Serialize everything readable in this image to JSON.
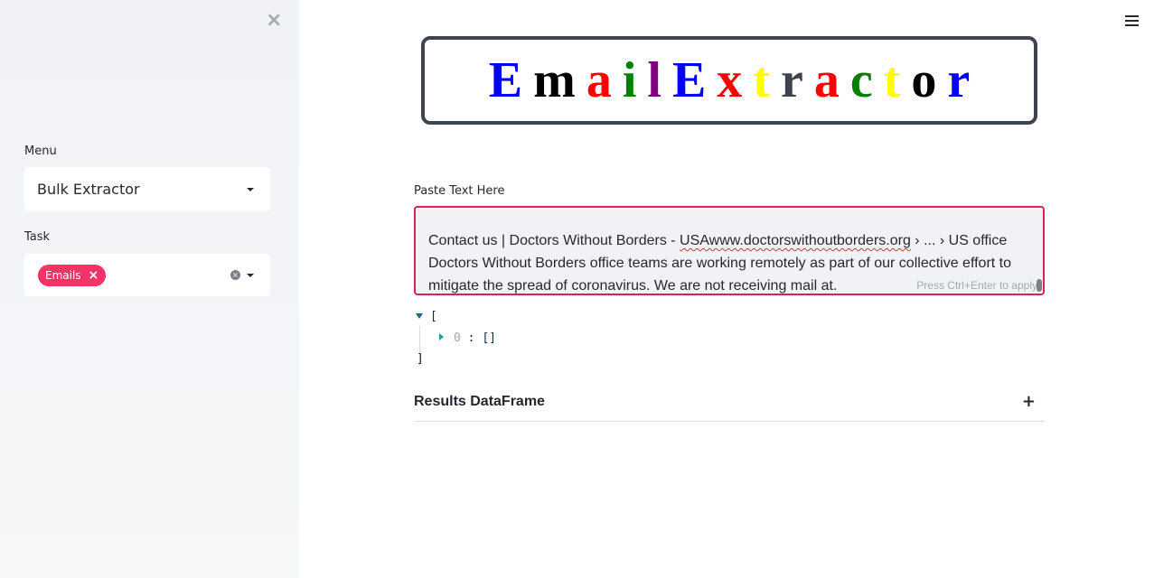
{
  "sidebar": {
    "close_glyph": "×",
    "menu": {
      "label": "Menu",
      "selected": "Bulk Extractor"
    },
    "task": {
      "label": "Task",
      "chips": [
        {
          "label": "Emails",
          "remove_glyph": "×"
        }
      ],
      "clear_glyph": "×"
    }
  },
  "header": {
    "menu_icon": "hamburger-icon"
  },
  "title": {
    "letters": [
      {
        "char": "E",
        "color": "#0000ff"
      },
      {
        "char": "m",
        "color": "#000000"
      },
      {
        "char": "a",
        "color": "#ff0000"
      },
      {
        "char": "i",
        "color": "#008000"
      },
      {
        "char": "l",
        "color": "#800080"
      },
      {
        "char": "E",
        "color": "#0000ff"
      },
      {
        "char": "x",
        "color": "#ff0000"
      },
      {
        "char": "t",
        "color": "#ffff00"
      },
      {
        "char": "r",
        "color": "#3d4450"
      },
      {
        "char": "a",
        "color": "#ff0000"
      },
      {
        "char": "c",
        "color": "#008000"
      },
      {
        "char": "t",
        "color": "#ffff00"
      },
      {
        "char": "o",
        "color": "#000000"
      },
      {
        "char": "r",
        "color": "#0000ff"
      }
    ]
  },
  "paste": {
    "label": "Paste Text Here",
    "text_segments": [
      {
        "text": "Contact us | Doctors Without Borders - ",
        "squiggle": false
      },
      {
        "text": "USAwww.doctorswithoutborders.org",
        "squiggle": true
      },
      {
        "text": " › ... › US office Doctors Without Borders office teams are working remotely as part of our collective effort to mitigate the spread of ",
        "squiggle": false
      },
      {
        "text": "coronavirus",
        "squiggle": true
      },
      {
        "text": ". We are not receiving mail at.",
        "squiggle": false
      }
    ],
    "hint": "Press Ctrl+Enter to apply"
  },
  "json_output": {
    "open_bracket": "[",
    "item_key": "0",
    "item_sep": " : ",
    "item_value": "[]",
    "close_bracket": "]"
  },
  "results": {
    "title": "Results DataFrame",
    "toggle": "+"
  },
  "colors": {
    "accent": "#f63366",
    "focus_border": "#e21d5e",
    "sidebar_bg": "#f0f2f6"
  }
}
